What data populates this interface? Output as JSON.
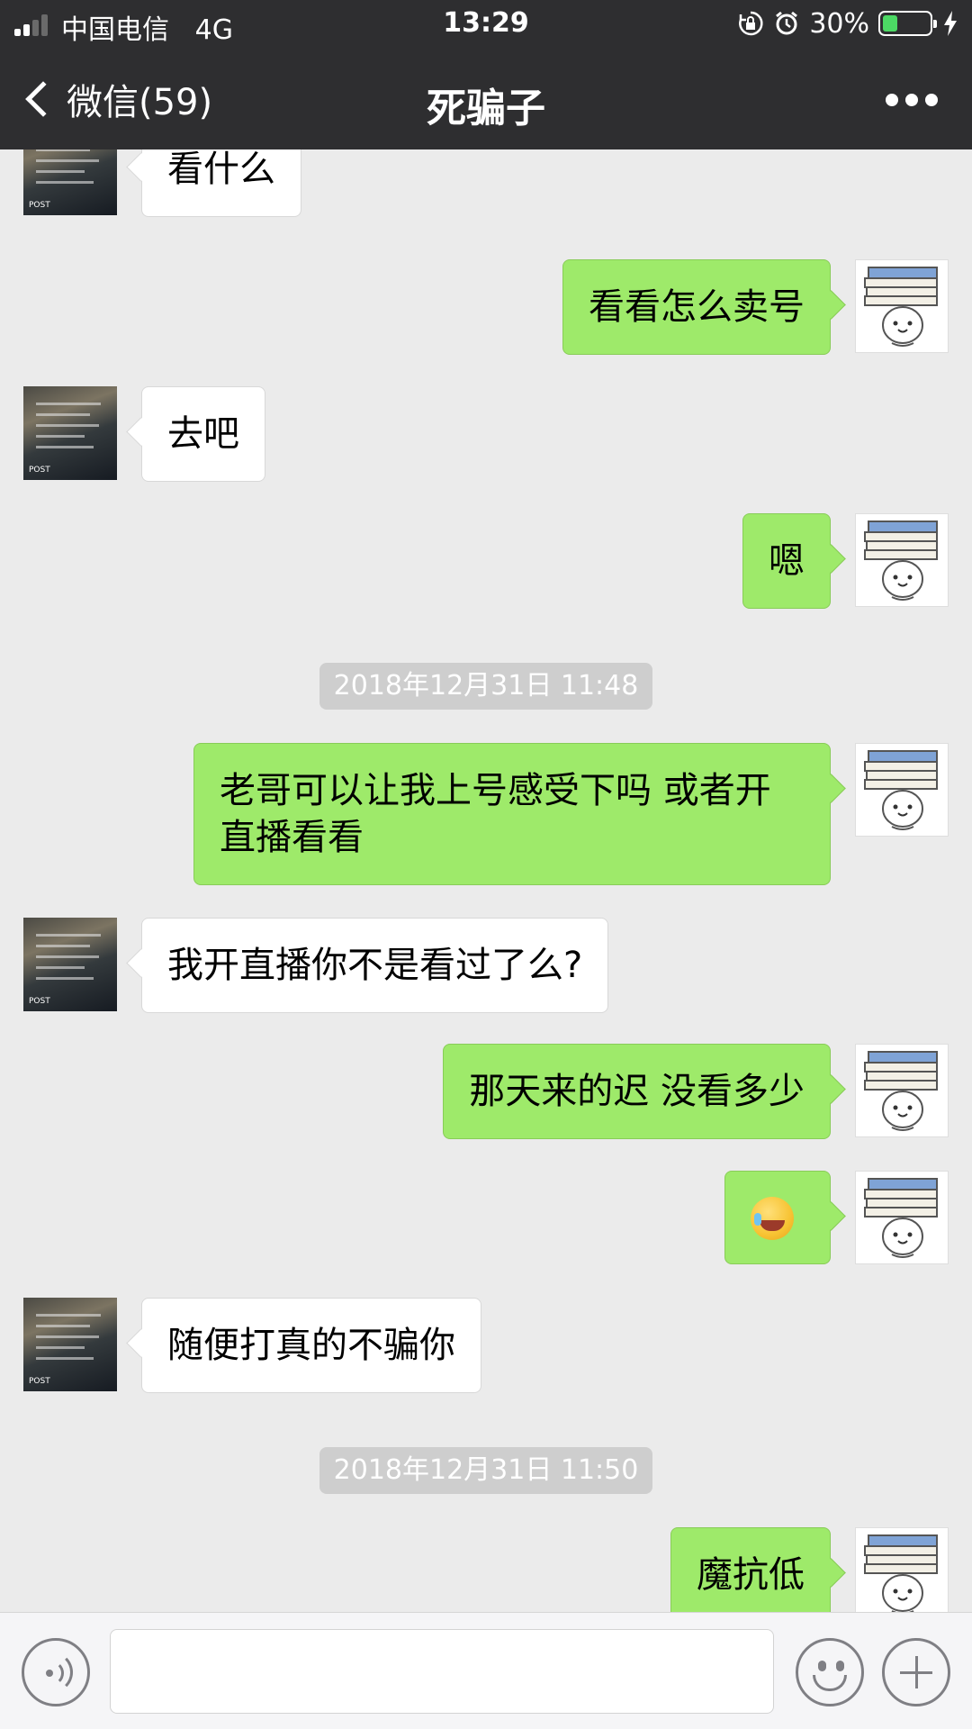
{
  "status_bar": {
    "carrier": "中国电信",
    "network": "4G",
    "time": "13:29",
    "battery_percent": "30%",
    "battery_level": 0.3,
    "battery_color": "#4cd964",
    "icons": [
      "signal-icon",
      "orientation-lock-icon",
      "alarm-icon",
      "battery-icon",
      "charging-bolt-icon"
    ]
  },
  "nav": {
    "back_label": "微信(59)",
    "title": "死骗子",
    "more_icon": "more-dots-icon"
  },
  "chat": {
    "m1": "看什么",
    "m2": "看看怎么卖号",
    "m3": "去吧",
    "m4": "嗯",
    "t1": "2018年12月31日 11:48",
    "m5": "老哥可以让我上号感受下吗 或者开直播看看",
    "m6": "我开直播你不是看过了么?",
    "m7": "那天来的迟 没看多少",
    "m8_emoji": "laughing-tears-emoji",
    "m9": "随便打真的不骗你",
    "t2": "2018年12月31日 11:50",
    "m10": "魔抗低"
  },
  "colors": {
    "header_bg": "#2e2e30",
    "chat_bg": "#ebebeb",
    "outgoing_bubble": "#9eea6a",
    "incoming_bubble": "#ffffff",
    "time_label_bg": "#cecece"
  },
  "input_bar": {
    "voice_icon": "voice-icon",
    "emoji_icon": "emoji-icon",
    "plus_icon": "plus-icon"
  }
}
